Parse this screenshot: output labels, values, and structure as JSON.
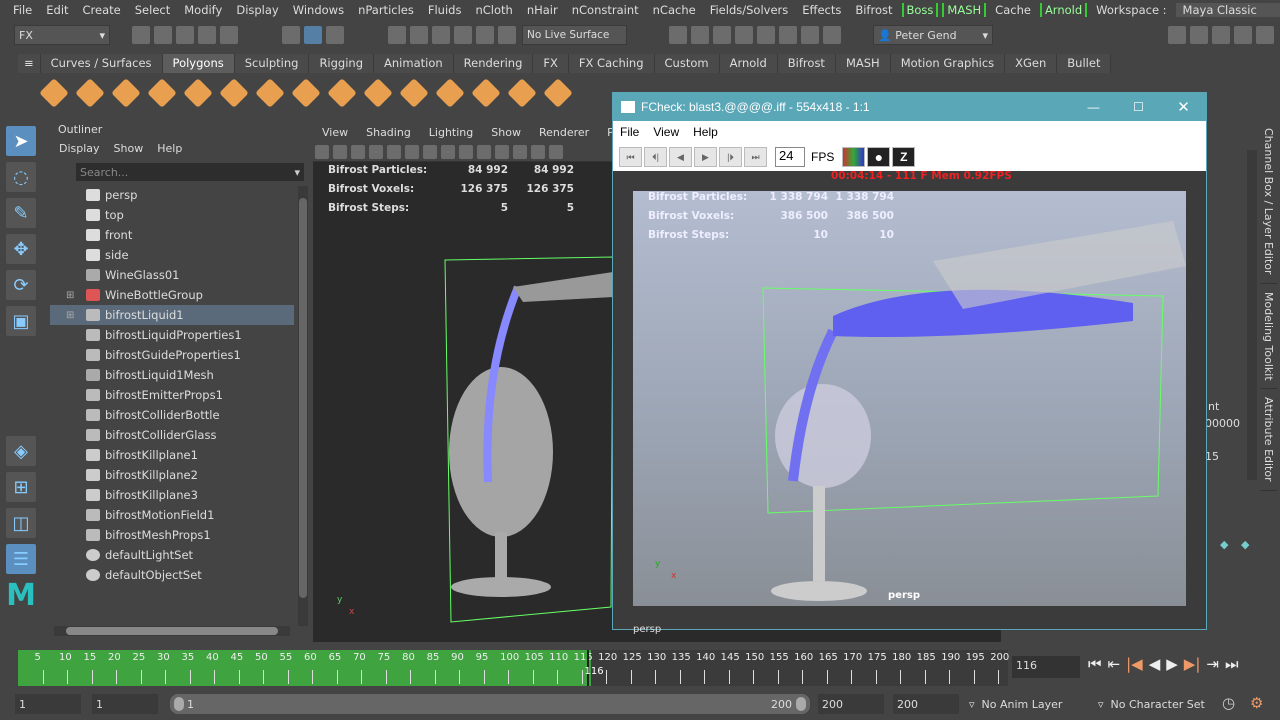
{
  "menubar": {
    "items": [
      "File",
      "Edit",
      "Create",
      "Select",
      "Modify",
      "Display",
      "Windows",
      "nParticles",
      "Fluids",
      "nCloth",
      "nHair",
      "nConstraint",
      "nCache",
      "Fields/Solvers",
      "Effects",
      "Bifrost"
    ],
    "bracketed1": [
      "Boss",
      "MASH"
    ],
    "cache": "Cache",
    "bracketed2": "Arnold",
    "workspace_label": "Workspace :",
    "workspace_value": "Maya Classic"
  },
  "status": {
    "menuset": "FX",
    "live_surface": "No Live Surface",
    "user": "Peter Gend"
  },
  "shelf": {
    "tabs": [
      "Curves / Surfaces",
      "Polygons",
      "Sculpting",
      "Rigging",
      "Animation",
      "Rendering",
      "FX",
      "FX Caching",
      "Custom",
      "Arnold",
      "Bifrost",
      "MASH",
      "Motion Graphics",
      "XGen",
      "Bullet"
    ],
    "active": "Polygons"
  },
  "outliner": {
    "title": "Outliner",
    "menu": [
      "Display",
      "Show",
      "Help"
    ],
    "search_placeholder": "Search...",
    "items": [
      {
        "name": "persp",
        "type": "camera"
      },
      {
        "name": "top",
        "type": "camera"
      },
      {
        "name": "front",
        "type": "camera"
      },
      {
        "name": "side",
        "type": "camera"
      },
      {
        "name": "WineGlass01",
        "type": "mesh"
      },
      {
        "name": "WineBottleGroup",
        "type": "group",
        "expand": "+"
      },
      {
        "name": "bifrostLiquid1",
        "type": "node",
        "expand": "+",
        "selected": true
      },
      {
        "name": "bifrostLiquidProperties1",
        "type": "node"
      },
      {
        "name": "bifrostGuideProperties1",
        "type": "node"
      },
      {
        "name": "bifrostLiquid1Mesh",
        "type": "mesh"
      },
      {
        "name": "bifrostEmitterProps1",
        "type": "node"
      },
      {
        "name": "bifrostColliderBottle",
        "type": "node"
      },
      {
        "name": "bifrostColliderGlass",
        "type": "node"
      },
      {
        "name": "bifrostKillplane1",
        "type": "plane"
      },
      {
        "name": "bifrostKillplane2",
        "type": "plane"
      },
      {
        "name": "bifrostKillplane3",
        "type": "plane"
      },
      {
        "name": "bifrostMotionField1",
        "type": "node"
      },
      {
        "name": "bifrostMeshProps1",
        "type": "node"
      },
      {
        "name": "defaultLightSet",
        "type": "set"
      },
      {
        "name": "defaultObjectSet",
        "type": "set"
      }
    ]
  },
  "viewport": {
    "menu": [
      "View",
      "Shading",
      "Lighting",
      "Show",
      "Renderer",
      "Panel"
    ],
    "hud": [
      [
        "Bifrost Particles:",
        "84 992",
        "84 992"
      ],
      [
        "Bifrost Voxels:",
        "126 375",
        "126 375"
      ],
      [
        "Bifrost Steps:",
        "5",
        "5"
      ]
    ],
    "camera": "persp"
  },
  "fcheck": {
    "title": "FCheck: blast3.@@@@.iff - 554x418 - 1:1",
    "menu": [
      "File",
      "View",
      "Help"
    ],
    "fps_value": "24",
    "fps_label": "FPS",
    "status": "00:04:14 - 111 F Mem 0.92FPS",
    "hud": [
      [
        "Bifrost Particles:",
        "1 338 794",
        "1 338 794"
      ],
      [
        "Bifrost Voxels:",
        "386 500",
        "386 500"
      ],
      [
        "Bifrost Steps:",
        "10",
        "10"
      ]
    ],
    "camera": "persp"
  },
  "channel": {
    "values": [
      "int",
      "00000",
      "15"
    ],
    "vertical_tabs": [
      "Channel Box / Layer Editor",
      "Modeling Toolkit",
      "Attribute Editor"
    ]
  },
  "timeline": {
    "ticks": [
      5,
      10,
      15,
      20,
      25,
      30,
      35,
      40,
      45,
      50,
      55,
      60,
      65,
      70,
      75,
      80,
      85,
      90,
      95,
      100,
      105,
      110,
      115,
      120,
      125,
      130,
      135,
      140,
      145,
      150,
      155,
      160,
      165,
      170,
      175,
      180,
      185,
      190,
      195,
      200
    ],
    "current_frame": 116,
    "current_field": "116",
    "cached_until": 116,
    "start": 1,
    "end": 200,
    "accent": "#3fa33f"
  },
  "range": {
    "start": "1",
    "playback_start": "1",
    "slider_start": "1",
    "slider_end": "200",
    "playback_end": "200",
    "end": "200",
    "anim_layer": "No Anim Layer",
    "character_set": "No Character Set"
  }
}
